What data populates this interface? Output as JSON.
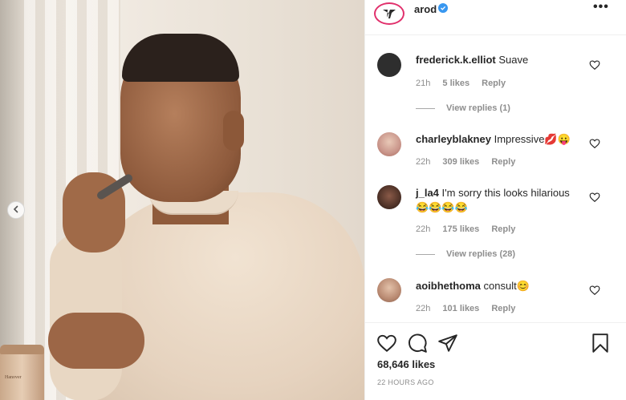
{
  "post": {
    "jar_label": "Hanover",
    "account": {
      "username": "arod",
      "verified": true
    },
    "more_label": "•••",
    "comments": [
      {
        "username": "frederick.k.elliot",
        "text": "Suave",
        "time": "21h",
        "likes": "5 likes",
        "reply": "Reply",
        "view_replies": "View replies (1)",
        "avatar_color": "#2e2e2e"
      },
      {
        "username": "charleyblakney",
        "text": "Impressive💋😛",
        "time": "22h",
        "likes": "309 likes",
        "reply": "Reply",
        "view_replies": null,
        "avatar_color": "#c9a58f"
      },
      {
        "username": "j_la4",
        "text": "I'm sorry this looks hilarious 😂😂😂😂",
        "time": "22h",
        "likes": "175 likes",
        "reply": "Reply",
        "view_replies": "View replies (28)",
        "avatar_color": "#4a2f25"
      },
      {
        "username": "aoibhethoma",
        "text": "consult😊",
        "time": "22h",
        "likes": "101 likes",
        "reply": "Reply",
        "view_replies": null,
        "avatar_color": "#b98a72"
      }
    ],
    "like_count": "68,646 likes",
    "timestamp": "22 HOURS AGO"
  }
}
